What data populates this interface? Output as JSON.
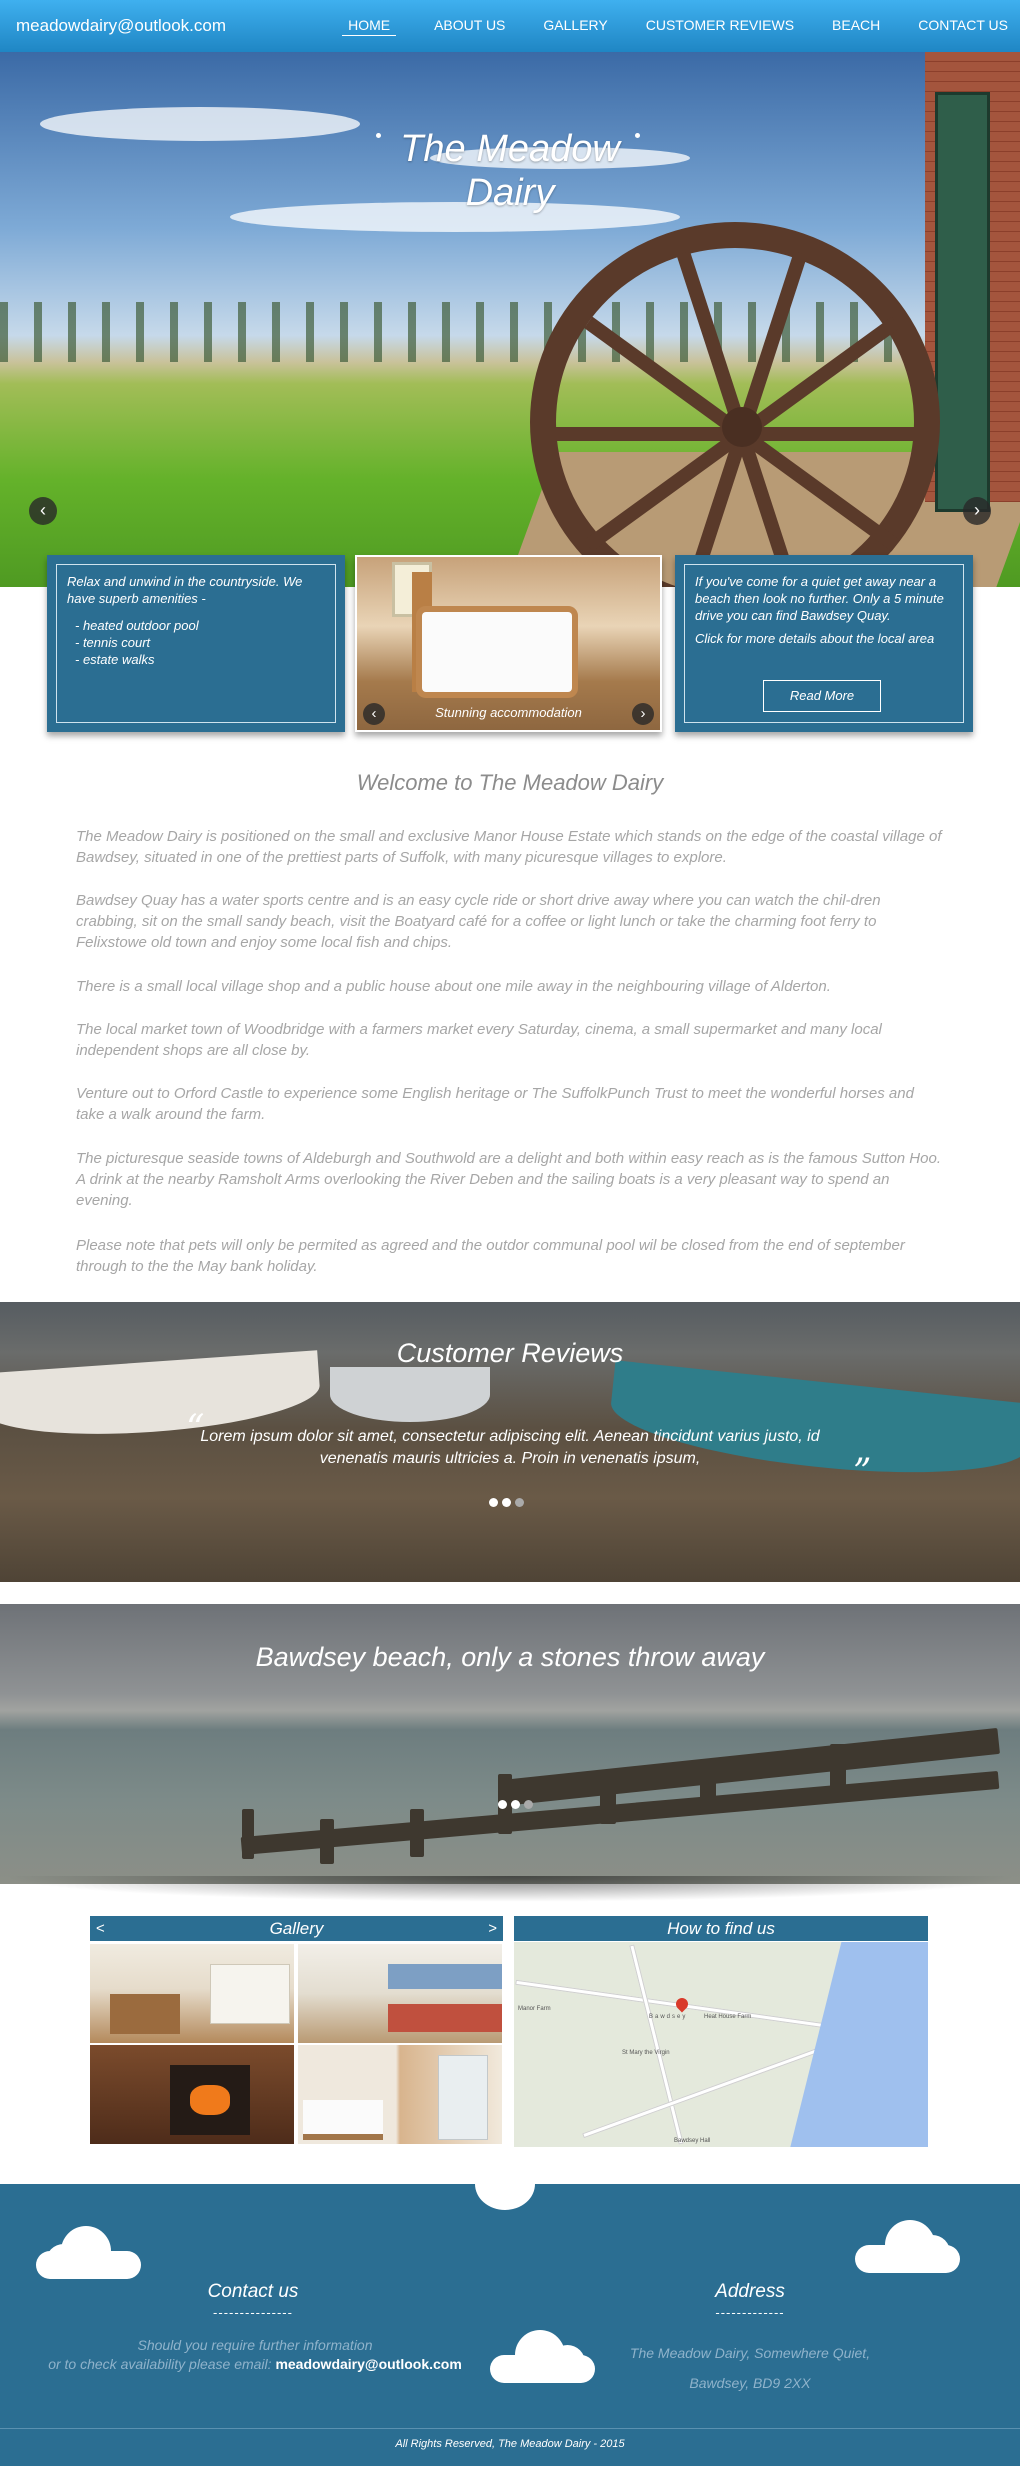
{
  "nav": {
    "email": "meadowdairy@outlook.com",
    "items": [
      "HOME",
      "ABOUT US",
      "GALLERY",
      "CUSTOMER REVIEWS",
      "BEACH",
      "CONTACT US"
    ]
  },
  "hero": {
    "title_line1": "The Meadow",
    "title_line2": "Dairy",
    "prev": "‹",
    "next": "›"
  },
  "cards": {
    "amenities_intro": "Relax and unwind in the countryside. We have superb amenities -",
    "amenities": [
      "- heated outdoor pool",
      "- tennis court",
      "- estate walks"
    ],
    "photo_caption": "Stunning accommodation",
    "beach_text": "If you've come for a quiet get away near a beach then look no further. Only a 5 minute drive you can find Bawdsey Quay.",
    "beach_link": "Click for more details about the local area",
    "read_more": "Read More"
  },
  "welcome": {
    "title": "Welcome to The Meadow Dairy",
    "paragraphs": [
      "The Meadow Dairy is positioned on the small and exclusive Manor House Estate which stands on the edge of the coastal village of Bawdsey, situated in one of the prettiest parts of Suffolk, with many picuresque villages to explore.",
      "Bawdsey Quay has a water sports centre and is an easy cycle ride or short drive away where you can watch the chil-dren crabbing, sit on the small sandy beach, visit the Boatyard café for a coffee or light lunch or take the charming foot ferry to Felixstowe old town and enjoy some local fish and chips.",
      "There is a small local village shop and a public house about one mile away in the neighbouring village of Alderton.",
      "The local market town of Woodbridge with a farmers market every Saturday, cinema, a small supermarket and many local independent shops are all close by.",
      "Venture out to Orford Castle to experience some English heritage or The SuffolkPunch Trust to meet the wonderful horses and take a walk around the farm.",
      "The picturesque seaside towns of Aldeburgh and Southwold are a delight and both within easy reach as is the famous Sutton Hoo. A drink at the nearby Ramsholt Arms overlooking the River Deben and the sailing boats is a very  pleasant way to spend an evening.",
      "Please note that pets will only be permited as agreed and the outdor communal pool wil be closed from the end of september through to the the May bank holiday."
    ]
  },
  "reviews": {
    "title": "Customer Reviews",
    "open_quote": "“",
    "close_quote": "”",
    "quote": "Lorem ipsum dolor sit amet, consectetur adipiscing elit. Aenean tincidunt varius justo, id venenatis mauris ultricies a. Proin in venenatis ipsum,"
  },
  "beach": {
    "title": "Bawdsey beach, only a stones throw away"
  },
  "gallery": {
    "title": "Gallery",
    "prev": "<",
    "next": ">"
  },
  "map": {
    "title": "How to find us",
    "labels": [
      "Manor Farm",
      "Bawdsey",
      "Heat House Farm",
      "St Mary the Virgin",
      "Bawdsey Hall"
    ]
  },
  "footer": {
    "contact_title": "Contact us",
    "dashes": "---------------",
    "contact_line1": "Should you require further information",
    "contact_line2": "or to check availability please email:",
    "contact_email": "meadowdairy@outlook.com",
    "address_title": "Address",
    "address_dashes": "-------------",
    "address_line1": "The Meadow Dairy, Somewhere Quiet,",
    "address_line2": "Bawdsey, BD9 2XX",
    "copyright": "All Rights Reserved, The Meadow Dairy - 2015"
  },
  "colors": {
    "nav": "#2596d6",
    "brand_blue": "#2b6e92",
    "body_text": "#a6a6a6"
  }
}
